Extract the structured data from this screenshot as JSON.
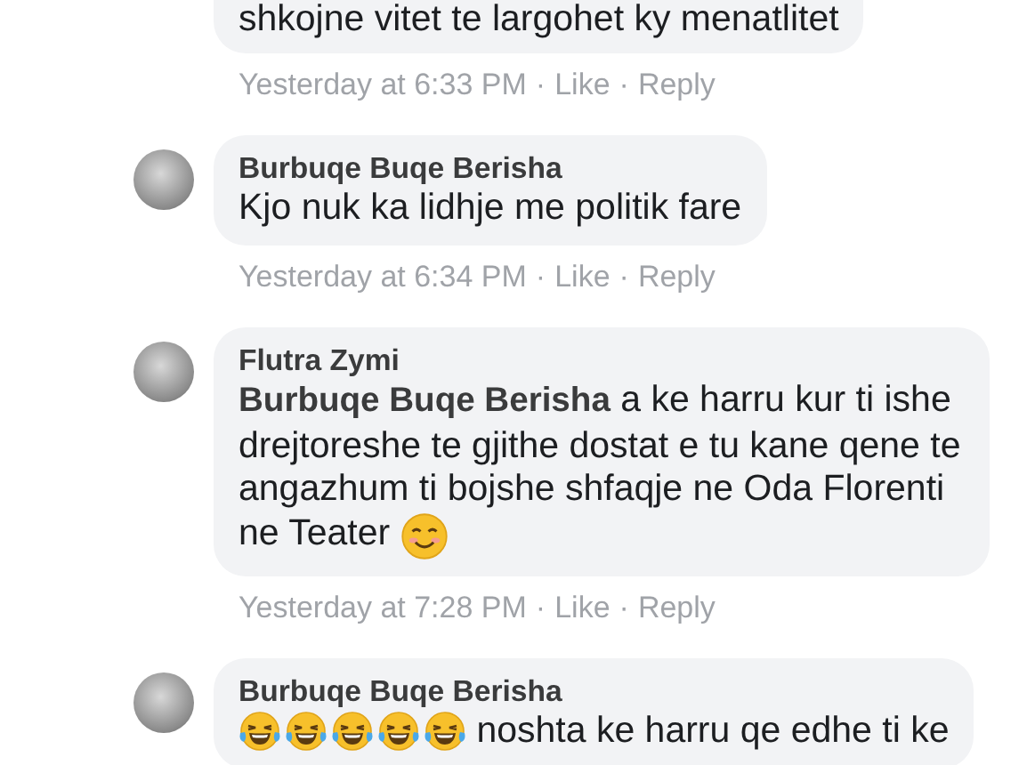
{
  "comments": [
    {
      "text": "shkojne vitet te largohet ky menatlitet",
      "meta": {
        "time": "Yesterday at 6:33 PM",
        "actions": [
          {
            "separator": "·",
            "link": "Like"
          },
          {
            "separator": "·",
            "link": "Reply"
          }
        ]
      }
    },
    {
      "author": "Burbuqe Buqe Berisha",
      "text": "Kjo nuk ka lidhje me politik fare",
      "meta": {
        "time": "Yesterday at 6:34 PM",
        "actions": [
          {
            "separator": "·",
            "link": "Like"
          },
          {
            "separator": "·",
            "link": "Reply"
          }
        ]
      }
    },
    {
      "author": "Flutra Zymi",
      "text": "**Burbuqe Buqe Berisha** a ke harru kur ti ishe drejtoreshe te gjithe dostat e tu kane qene te angazhum ti bojshe shfaqje ne Oda Florenti ne Teater",
      "emojis_after": [
        {
          "kind": "smiling"
        }
      ],
      "meta": {
        "time": "Yesterday at 7:28 PM",
        "actions": [
          {
            "separator": "·",
            "link": "Like"
          },
          {
            "separator": "·",
            "link": "Reply"
          }
        ]
      }
    },
    {
      "author": "Burbuqe Buqe Berisha",
      "emojis_before": [
        {
          "kind": "laughing"
        },
        {
          "kind": "laughing"
        },
        {
          "kind": "laughing"
        },
        {
          "kind": "laughing"
        },
        {
          "kind": "laughing"
        }
      ],
      "text": "noshta ke harru qe edhe ti ke"
    }
  ]
}
